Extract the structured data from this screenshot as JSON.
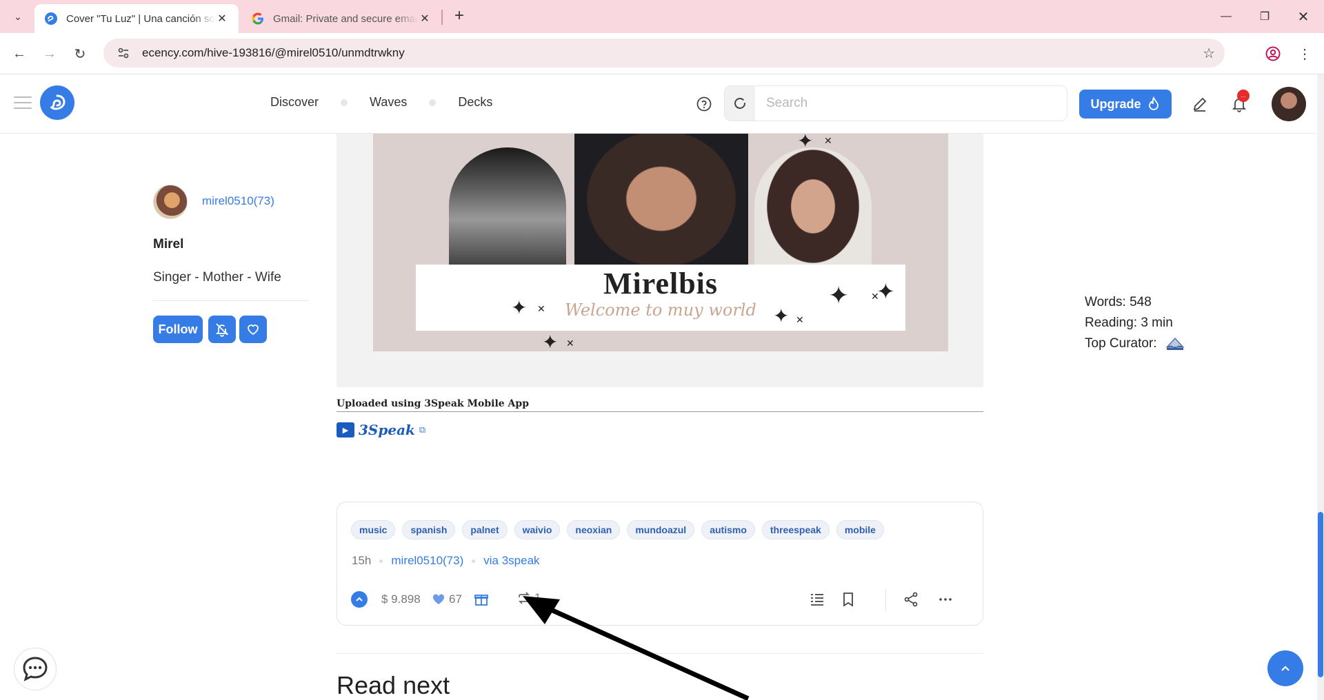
{
  "browser": {
    "tabs": [
      {
        "title": "Cover \"Tu Luz\" | Una canción so",
        "active": true
      },
      {
        "title": "Gmail: Private and secure email",
        "active": false
      }
    ],
    "url": "ecency.com/hive-193816/@mirel0510/unmdtrwkny"
  },
  "header": {
    "nav": [
      "Discover",
      "Waves",
      "Decks"
    ],
    "search_placeholder": "Search",
    "upgrade_label": "Upgrade",
    "notification_badge": "..."
  },
  "author": {
    "handle": "mirel0510(73)",
    "name": "Mirel",
    "bio": "Singer - Mother - Wife",
    "follow_label": "Follow"
  },
  "video": {
    "banner_title": "Mirelbis",
    "banner_subtitle": "Welcome to muy world"
  },
  "post": {
    "uploaded_note": "Uploaded using 3Speak Mobile App",
    "speak_link": "3Speak"
  },
  "footer": {
    "tags": [
      "music",
      "spanish",
      "palnet",
      "waivio",
      "neoxian",
      "mundoazul",
      "autismo",
      "threespeak",
      "mobile"
    ],
    "age": "15h",
    "author": "mirel0510(73)",
    "via": "via 3speak",
    "payout": "$ 9.898",
    "votes": "67",
    "reblogs": "1"
  },
  "stats": {
    "words": "Words: 548",
    "reading": "Reading: 3 min",
    "top_curator": "Top Curator:"
  },
  "read_next": "Read next",
  "colors": {
    "accent": "#357ce6",
    "tabbar": "#f9d9df",
    "badge": "#e52b2b"
  }
}
